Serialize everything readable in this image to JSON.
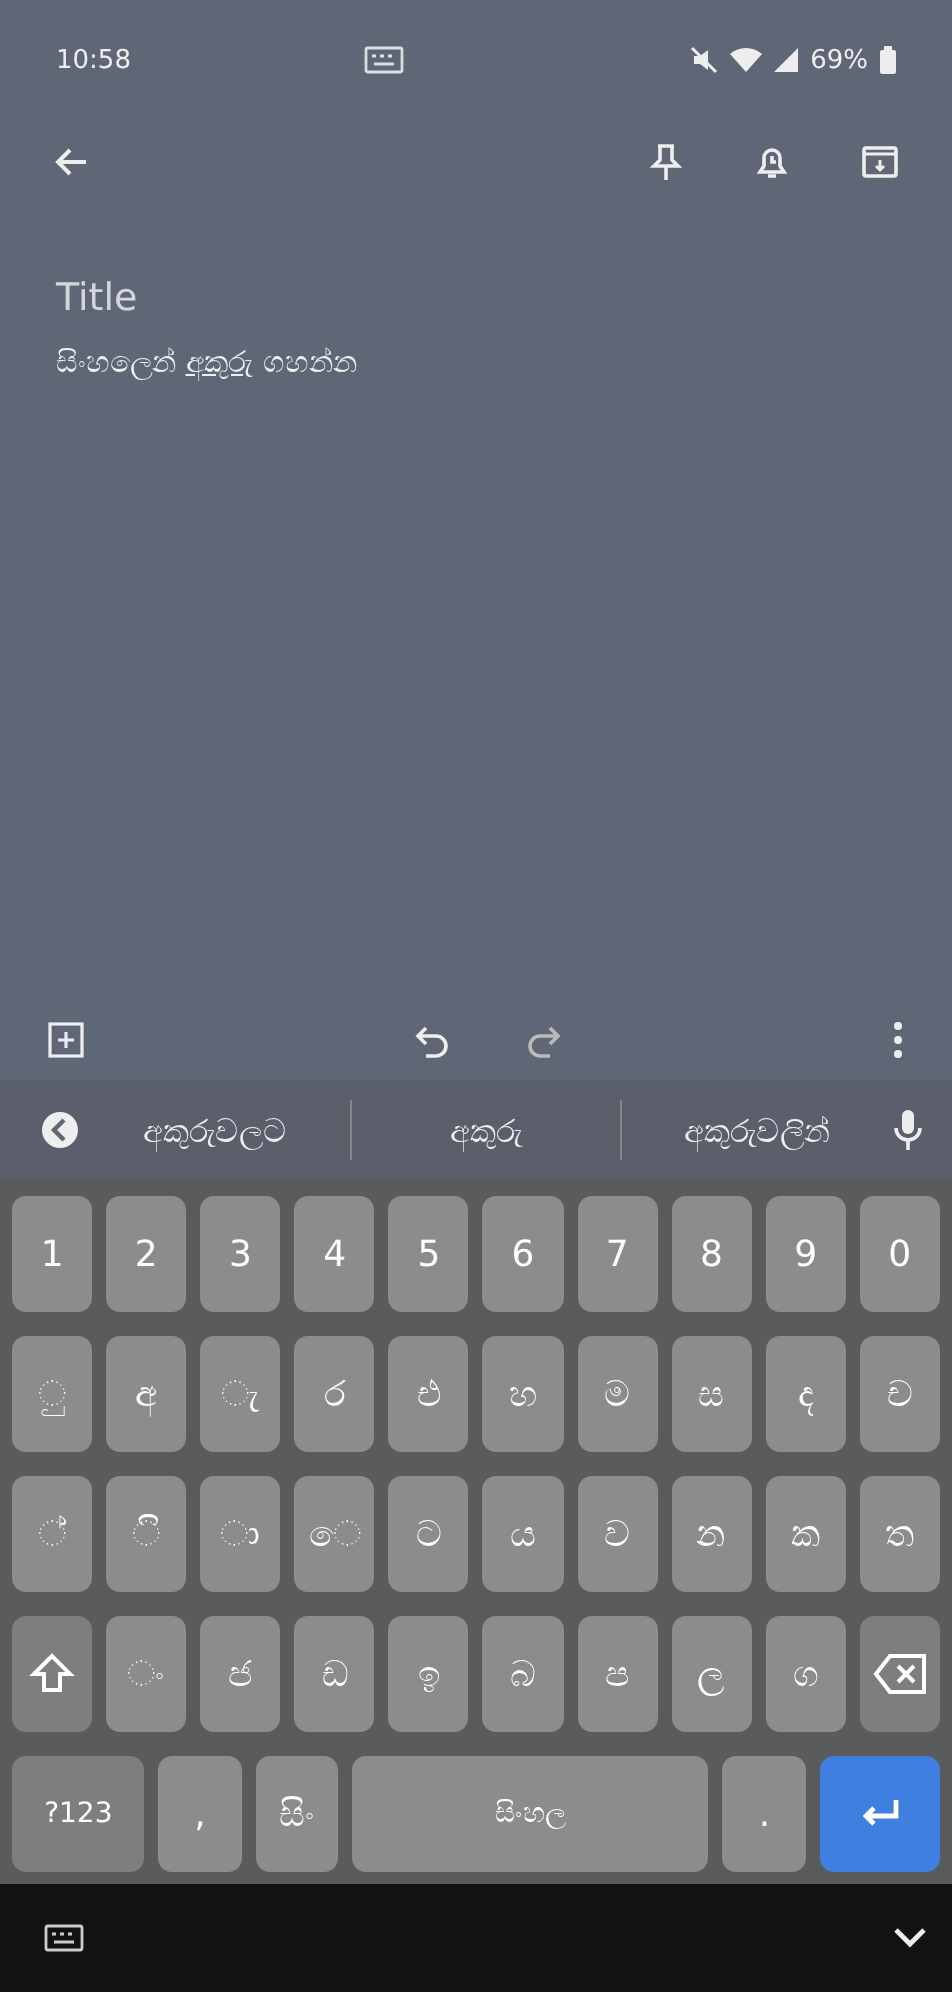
{
  "status_bar": {
    "time": "10:58",
    "battery": "69%"
  },
  "note": {
    "title_placeholder": "Title",
    "body": "සිංහලෙන් **අකුරු** ගහන්න"
  },
  "suggestions": [
    "අකුරුවලට",
    "අකුරු",
    "අකුරුවලින්"
  ],
  "keyboard": {
    "rows": [
      [
        {
          "kind": "char",
          "label": "1"
        },
        {
          "kind": "char",
          "label": "2"
        },
        {
          "kind": "char",
          "label": "3"
        },
        {
          "kind": "char",
          "label": "4"
        },
        {
          "kind": "char",
          "label": "5"
        },
        {
          "kind": "char",
          "label": "6"
        },
        {
          "kind": "char",
          "label": "7"
        },
        {
          "kind": "char",
          "label": "8"
        },
        {
          "kind": "char",
          "label": "9"
        },
        {
          "kind": "char",
          "label": "0"
        }
      ],
      [
        {
          "kind": "char",
          "label": "ු"
        },
        {
          "kind": "char",
          "label": "අ"
        },
        {
          "kind": "char",
          "label": "ැ"
        },
        {
          "kind": "char",
          "label": "ර"
        },
        {
          "kind": "char",
          "label": "එ"
        },
        {
          "kind": "char",
          "label": "හ"
        },
        {
          "kind": "char",
          "label": "ම"
        },
        {
          "kind": "char",
          "label": "ස"
        },
        {
          "kind": "char",
          "label": "ද"
        },
        {
          "kind": "char",
          "label": "ච"
        }
      ],
      [
        {
          "kind": "char",
          "label": "්"
        },
        {
          "kind": "char",
          "label": "ි"
        },
        {
          "kind": "char",
          "label": "ා"
        },
        {
          "kind": "char",
          "label": "ෙ"
        },
        {
          "kind": "char",
          "label": "ට"
        },
        {
          "kind": "char",
          "label": "ය"
        },
        {
          "kind": "char",
          "label": "ව"
        },
        {
          "kind": "char",
          "label": "න"
        },
        {
          "kind": "char",
          "label": "ක"
        },
        {
          "kind": "char",
          "label": "ත"
        }
      ],
      [
        {
          "kind": "shift"
        },
        {
          "kind": "char",
          "label": "ං"
        },
        {
          "kind": "char",
          "label": "ජ"
        },
        {
          "kind": "char",
          "label": "ඩ"
        },
        {
          "kind": "char",
          "label": "ඉ"
        },
        {
          "kind": "char",
          "label": "බ"
        },
        {
          "kind": "char",
          "label": "ප"
        },
        {
          "kind": "char",
          "label": "ල"
        },
        {
          "kind": "char",
          "label": "ග"
        },
        {
          "kind": "backspace"
        }
      ]
    ],
    "bottom_row": [
      {
        "kind": "symbols",
        "label": "?123"
      },
      {
        "kind": "char",
        "label": ","
      },
      {
        "kind": "char",
        "label": "සිං"
      },
      {
        "kind": "space",
        "label": "සිංහල"
      },
      {
        "kind": "char",
        "label": "."
      },
      {
        "kind": "enter"
      }
    ]
  }
}
